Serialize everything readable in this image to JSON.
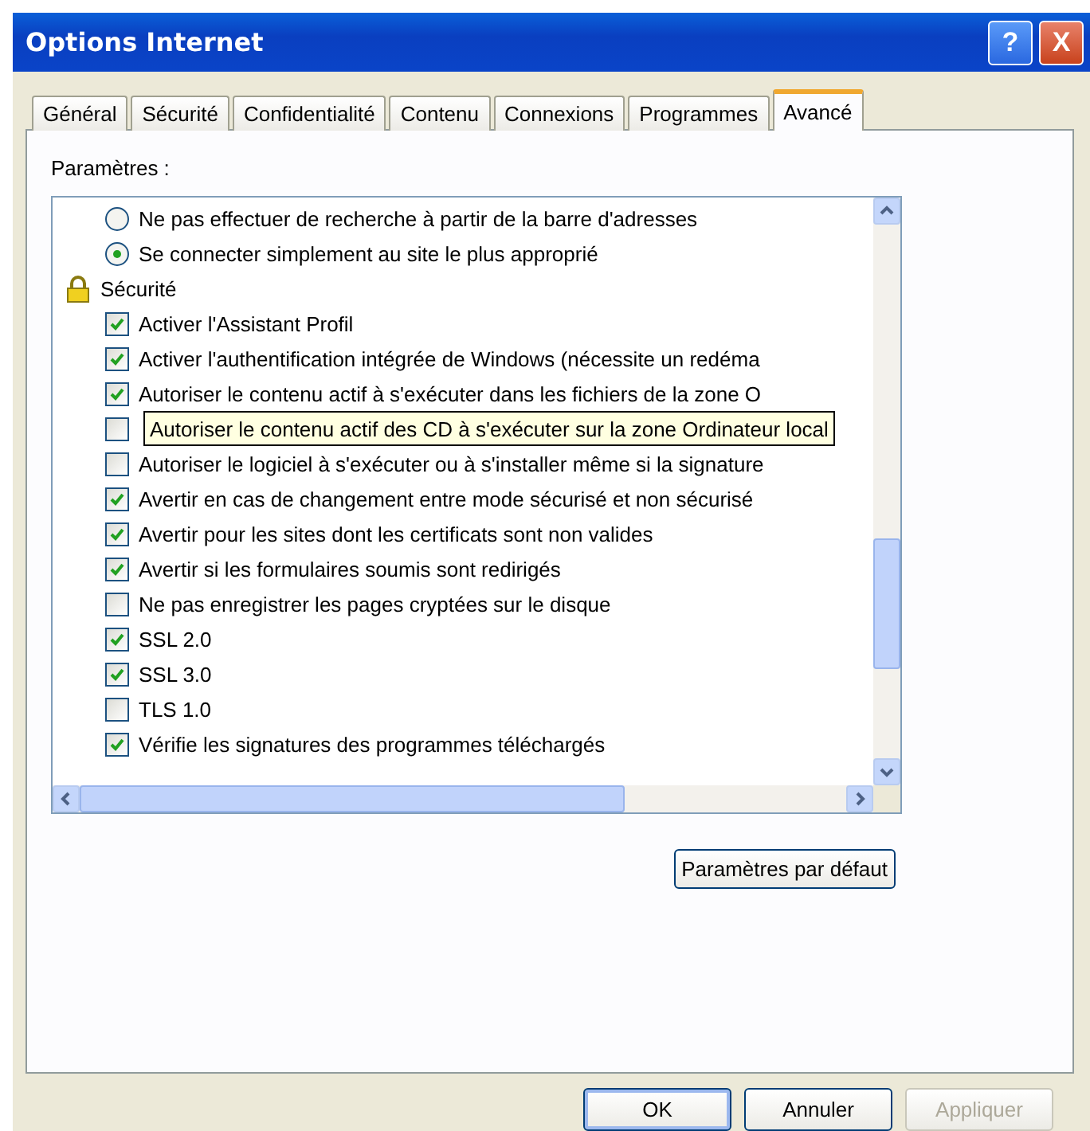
{
  "window": {
    "title": "Options Internet",
    "help_label": "?",
    "close_label": "X"
  },
  "tabs": [
    {
      "label": "Général",
      "selected": false
    },
    {
      "label": "Sécurité",
      "selected": false
    },
    {
      "label": "Confidentialité",
      "selected": false
    },
    {
      "label": "Contenu",
      "selected": false
    },
    {
      "label": "Connexions",
      "selected": false
    },
    {
      "label": "Programmes",
      "selected": false
    },
    {
      "label": "Avancé",
      "selected": true
    }
  ],
  "settings_label": "Paramètres :",
  "settings": [
    {
      "kind": "radio",
      "label": "Ne pas effectuer de recherche à partir de la barre d'adresses",
      "selected": false
    },
    {
      "kind": "radio",
      "label": "Se connecter simplement au site le plus approprié",
      "selected": true
    },
    {
      "kind": "group",
      "label": "Sécurité"
    },
    {
      "kind": "checkbox",
      "label": "Activer l'Assistant Profil",
      "checked": true
    },
    {
      "kind": "checkbox",
      "label": "Activer l'authentification intégrée de Windows (nécessite un redéma",
      "checked": true
    },
    {
      "kind": "checkbox",
      "label": "Autoriser le contenu actif à s'exécuter dans les fichiers de la zone O",
      "checked": true
    },
    {
      "kind": "checkbox",
      "label": "Autoriser le contenu actif des CD à s'exécuter sur la zone Ordinateur local",
      "checked": false,
      "tooltip": true
    },
    {
      "kind": "checkbox",
      "label": "Autoriser le logiciel à s'exécuter ou à s'installer même si la signature",
      "checked": false
    },
    {
      "kind": "checkbox",
      "label": "Avertir en cas de changement entre mode sécurisé et non sécurisé",
      "checked": true
    },
    {
      "kind": "checkbox",
      "label": "Avertir pour les sites dont les certificats sont non valides",
      "checked": true
    },
    {
      "kind": "checkbox",
      "label": "Avertir si les formulaires soumis sont redirigés",
      "checked": true
    },
    {
      "kind": "checkbox",
      "label": "Ne pas enregistrer les pages cryptées sur le disque",
      "checked": false
    },
    {
      "kind": "checkbox",
      "label": "SSL 2.0",
      "checked": true
    },
    {
      "kind": "checkbox",
      "label": "SSL 3.0",
      "checked": true
    },
    {
      "kind": "checkbox",
      "label": "TLS 1.0",
      "checked": false
    },
    {
      "kind": "checkbox",
      "label": "Vérifie les signatures des programmes téléchargés",
      "checked": true
    }
  ],
  "defaults_button": "Paramètres par défaut",
  "buttons": [
    {
      "label": "OK",
      "kind": "default",
      "disabled": false
    },
    {
      "label": "Annuler",
      "kind": "normal",
      "disabled": false
    },
    {
      "label": "Appliquer",
      "kind": "normal",
      "disabled": true
    }
  ]
}
